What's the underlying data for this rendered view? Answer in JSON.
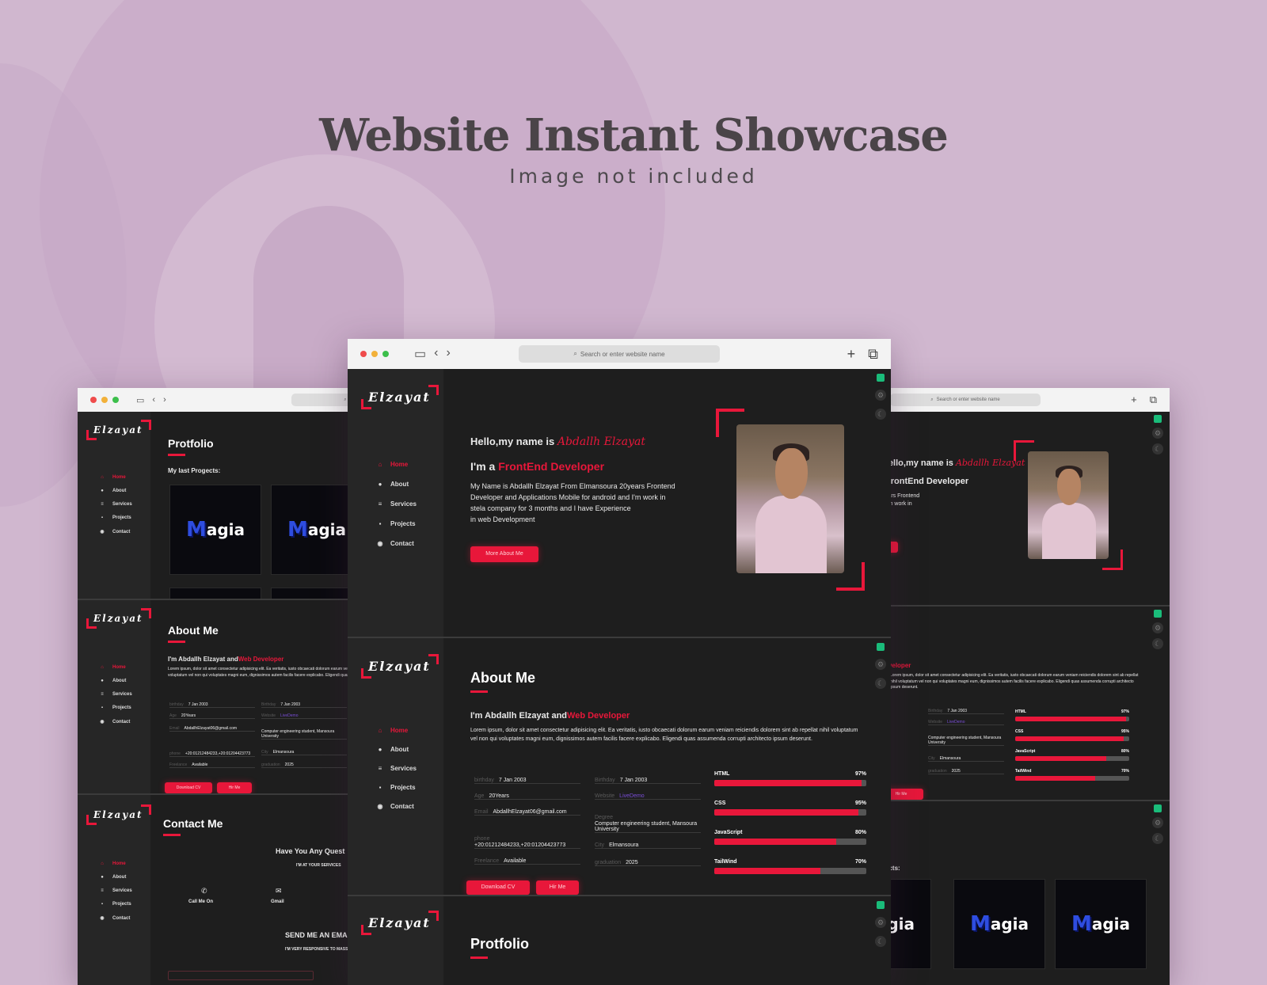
{
  "showcase": {
    "title": "Website Instant Showcase",
    "subtitle": "Image not included"
  },
  "browser": {
    "address_placeholder": "Search or enter website name"
  },
  "site": {
    "logo": "Elzayat",
    "menu": [
      "Home",
      "About",
      "Services",
      "Projects",
      "Contact"
    ],
    "hero": {
      "greeting": "Hello,my name is",
      "name": "Abdallh Elzayat",
      "role_prefix": "I'm a",
      "role": "FrontEnd Developer",
      "bio_lines": [
        "My Name is Abdallh Elzayat From Elmansoura 20years Frontend",
        "Developer and Applications Mobile for android and I'm work in",
        "stela company for 3 months and I have Experience",
        "in web Development"
      ],
      "button": "More About Me"
    },
    "about": {
      "title": "About Me",
      "intro_prefix": "I'm Abdallh Elzayat and",
      "intro_role": "Web Developer",
      "lorem": "Lorem ipsum, dolor sit amet consectetur adipisicing elit. Ea veritatis, iusto obcaecati dolorum earum veniam reiciendis dolorem sint ab repellat nihil voluptatum vel non qui voluptates magni eum, dignissimos autem facilis facere explicabo. Eligendi quas assumenda corrupti architecto ipsum deserunt.",
      "info_left": [
        {
          "k": "birthday",
          "v": "7 Jan 2003"
        },
        {
          "k": "Age",
          "v": "20Years"
        },
        {
          "k": "Email",
          "v": "AbdallhElzayat06@gmail.com"
        },
        {
          "k": "phone",
          "v": "+20:01212484233,+20:01204423773"
        },
        {
          "k": "Freelance",
          "v": "Available"
        }
      ],
      "info_right": [
        {
          "k": "Birthday",
          "v": "7 Jan 2003"
        },
        {
          "k": "Website",
          "v": "LiveDemo"
        },
        {
          "k": "Degree",
          "v": "Computer engineering student, Mansoura University"
        },
        {
          "k": "City",
          "v": "Elmansoura"
        },
        {
          "k": "graduation",
          "v": "2025"
        }
      ],
      "skills": [
        {
          "name": "HTML",
          "percent": 97,
          "label": "97%"
        },
        {
          "name": "CSS",
          "percent": 95,
          "label": "95%"
        },
        {
          "name": "JavaScript",
          "percent": 80,
          "label": "80%"
        },
        {
          "name": "TailWind",
          "percent": 70,
          "label": "70%"
        }
      ],
      "download_button": "Download CV",
      "hire_button": "Hir Me"
    },
    "portfolio": {
      "title": "Protfolio",
      "subtitle": "My last Progects:",
      "card_m": "M",
      "card_rest": "agia"
    },
    "contact": {
      "title": "Contact Me",
      "question": "Have You Any Quest",
      "services_note": "I'M AT YOUR SERVICES",
      "call_label": "Call Me On",
      "gmail_label": "Gmail",
      "send_email": "SEND ME AN EMA",
      "responsive_note": "I'M VERY RESPONSIVE TO MASSE"
    }
  }
}
